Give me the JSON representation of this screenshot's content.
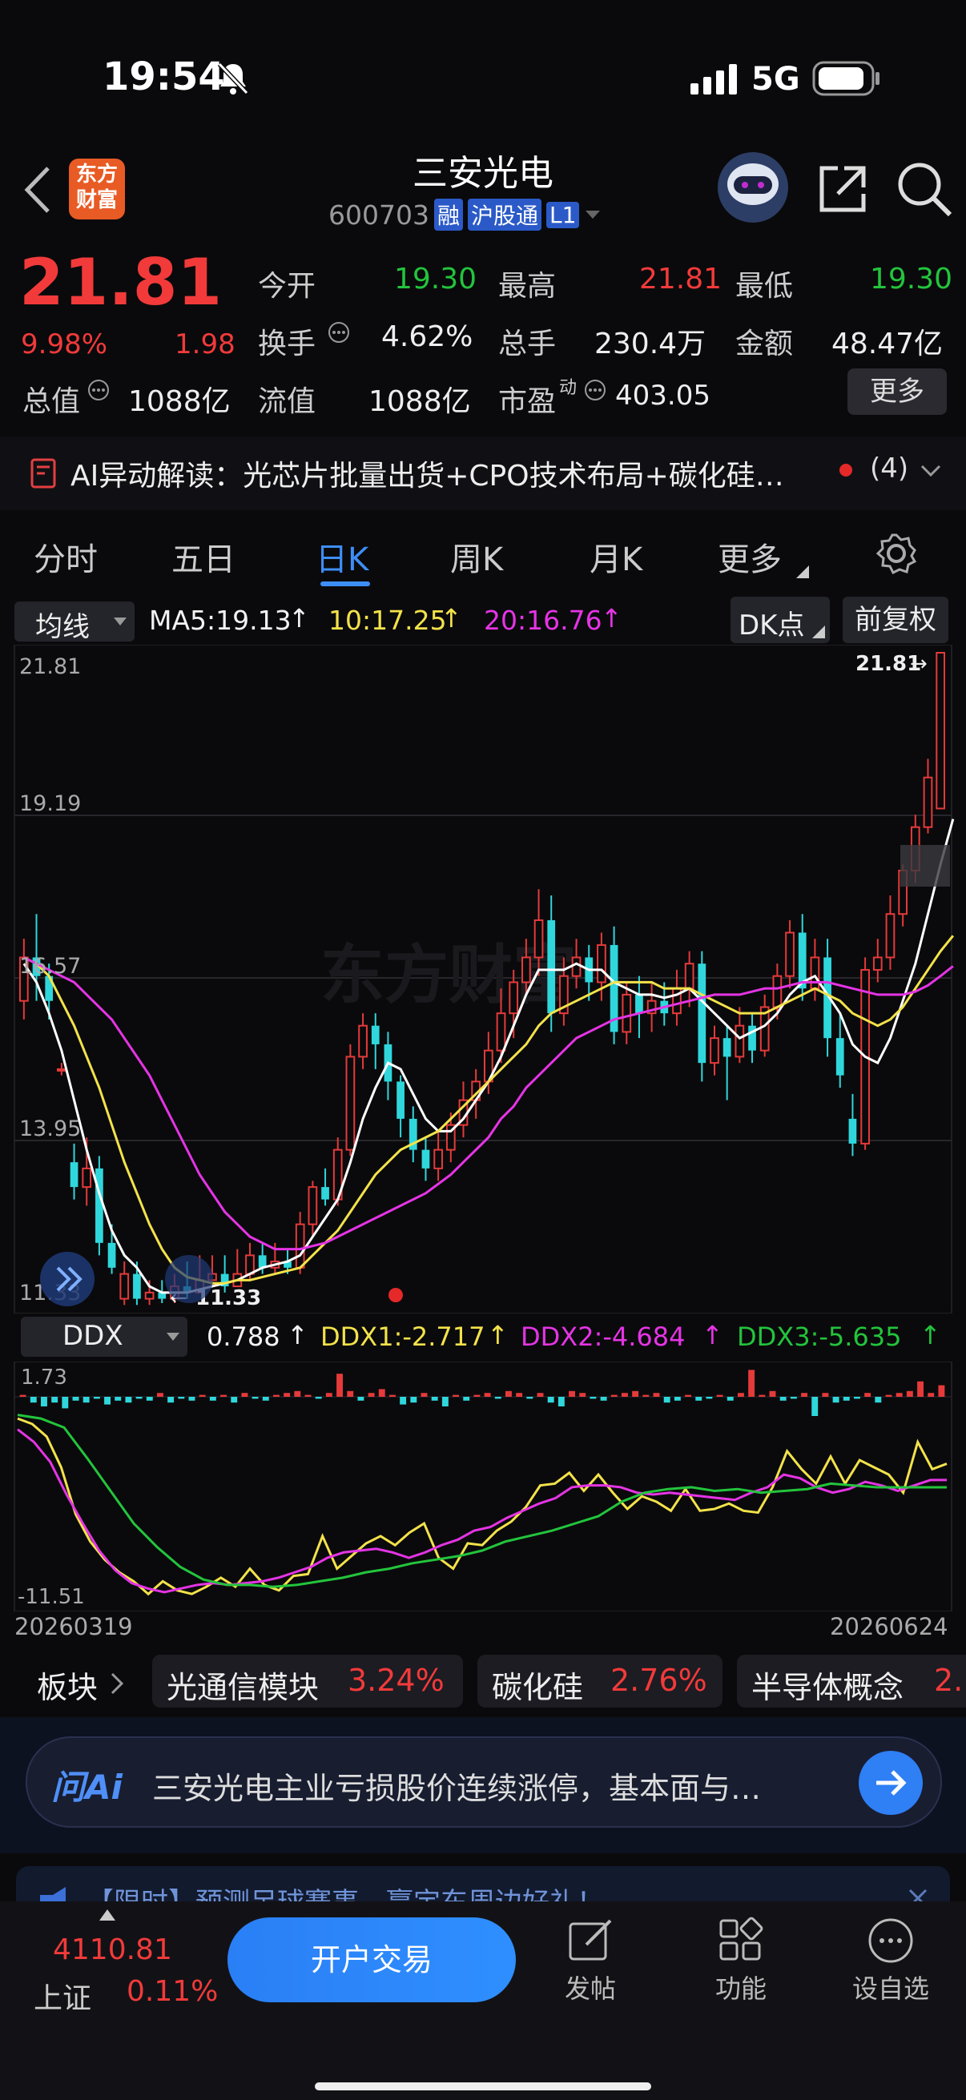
{
  "status_bar": {
    "time": "19:54",
    "network": "5G"
  },
  "header": {
    "back_icon": "chevron-left-icon",
    "logo_text_line1": "东方",
    "logo_text_line2": "财富",
    "title": "三安光电",
    "code": "600703",
    "badges": [
      "融",
      "沪股通",
      "L1"
    ]
  },
  "quote": {
    "price": "21.81",
    "change_pct": "9.98%",
    "change": "1.98",
    "labels": {
      "open": "今开",
      "high": "最高",
      "low": "最低",
      "turnover": "换手",
      "volume": "总手",
      "amount": "金额",
      "mktcap": "总值",
      "float": "流值",
      "pe": "市盈",
      "pe_sup": "动",
      "more": "更多"
    },
    "values": {
      "open": "19.30",
      "high": "21.81",
      "low": "19.30",
      "turnover": "4.62%",
      "volume": "230.4万",
      "amount": "48.47亿",
      "mktcap": "1088亿",
      "float": "1088亿",
      "pe": "403.05"
    }
  },
  "ai_banner": {
    "text": "AI异动解读：光芯片批量出货+CPO技术布局+碳化硅…",
    "count": "(4)"
  },
  "tabs": [
    "分时",
    "五日",
    "日K",
    "周K",
    "月K",
    "更多"
  ],
  "active_tab": "日K",
  "ma_bar": {
    "selector": "均线",
    "ma5": "MA5:19.13",
    "ma10": "10:17.25",
    "ma20": "20:16.76",
    "dk_label": "DK点",
    "restore_label": "前复权"
  },
  "chart_data": {
    "type": "line",
    "title": "",
    "y_ticks": [
      "21.81",
      "19.19",
      "16.57",
      "13.95",
      "11.33"
    ],
    "ylim": [
      11.33,
      21.81
    ],
    "price_high_label": "21.81",
    "price_low_label": "11.33",
    "x_start": "20260319",
    "x_end": "20260624",
    "watermark": "东方财富",
    "candles": [
      {
        "o": 16.2,
        "c": 16.9,
        "h": 17.2,
        "l": 15.9
      },
      {
        "o": 16.9,
        "c": 16.6,
        "h": 17.6,
        "l": 16.2
      },
      {
        "o": 16.6,
        "c": 16.2,
        "h": 16.8,
        "l": 15.9
      },
      {
        "o": 15.1,
        "c": 15.1,
        "h": 15.2,
        "l": 15.0
      },
      {
        "o": 13.6,
        "c": 13.2,
        "h": 13.9,
        "l": 13.0
      },
      {
        "o": 13.2,
        "c": 13.5,
        "h": 14.0,
        "l": 12.9
      },
      {
        "o": 13.5,
        "c": 12.3,
        "h": 13.7,
        "l": 12.1
      },
      {
        "o": 12.3,
        "c": 11.9,
        "h": 12.6,
        "l": 11.8
      },
      {
        "o": 11.4,
        "c": 11.8,
        "h": 12.0,
        "l": 11.3
      },
      {
        "o": 11.8,
        "c": 11.4,
        "h": 12.0,
        "l": 11.3
      },
      {
        "o": 11.4,
        "c": 11.5,
        "h": 11.7,
        "l": 11.3
      },
      {
        "o": 11.5,
        "c": 11.4,
        "h": 11.7,
        "l": 11.33
      },
      {
        "o": 11.4,
        "c": 11.6,
        "h": 11.8,
        "l": 11.33
      },
      {
        "o": 11.6,
        "c": 11.5,
        "h": 12.0,
        "l": 11.4
      },
      {
        "o": 11.5,
        "c": 11.7,
        "h": 12.1,
        "l": 11.5
      },
      {
        "o": 11.7,
        "c": 11.8,
        "h": 12.1,
        "l": 11.6
      },
      {
        "o": 11.8,
        "c": 11.6,
        "h": 12.1,
        "l": 11.5
      },
      {
        "o": 11.6,
        "c": 11.8,
        "h": 12.2,
        "l": 11.6
      },
      {
        "o": 11.8,
        "c": 12.1,
        "h": 12.3,
        "l": 11.7
      },
      {
        "o": 12.1,
        "c": 11.9,
        "h": 12.3,
        "l": 11.8
      },
      {
        "o": 11.9,
        "c": 12.0,
        "h": 12.3,
        "l": 11.8
      },
      {
        "o": 12.0,
        "c": 11.9,
        "h": 12.2,
        "l": 11.8
      },
      {
        "o": 11.9,
        "c": 12.6,
        "h": 12.8,
        "l": 11.8
      },
      {
        "o": 12.6,
        "c": 13.2,
        "h": 13.3,
        "l": 12.4
      },
      {
        "o": 13.2,
        "c": 13.0,
        "h": 13.5,
        "l": 12.9
      },
      {
        "o": 13.0,
        "c": 13.8,
        "h": 14.0,
        "l": 12.9
      },
      {
        "o": 13.8,
        "c": 15.3,
        "h": 15.5,
        "l": 13.7
      },
      {
        "o": 15.3,
        "c": 15.8,
        "h": 16.0,
        "l": 15.1
      },
      {
        "o": 15.8,
        "c": 15.5,
        "h": 16.0,
        "l": 15.1
      },
      {
        "o": 15.5,
        "c": 14.9,
        "h": 15.7,
        "l": 14.6
      },
      {
        "o": 14.9,
        "c": 14.3,
        "h": 15.0,
        "l": 14.0
      },
      {
        "o": 14.3,
        "c": 13.8,
        "h": 14.5,
        "l": 13.6
      },
      {
        "o": 13.8,
        "c": 13.5,
        "h": 14.0,
        "l": 13.3
      },
      {
        "o": 13.5,
        "c": 13.8,
        "h": 14.1,
        "l": 13.3
      },
      {
        "o": 13.8,
        "c": 14.2,
        "h": 14.4,
        "l": 13.6
      },
      {
        "o": 14.2,
        "c": 14.6,
        "h": 14.9,
        "l": 14.0
      },
      {
        "o": 14.6,
        "c": 14.9,
        "h": 15.1,
        "l": 14.3
      },
      {
        "o": 14.9,
        "c": 15.4,
        "h": 15.7,
        "l": 14.7
      },
      {
        "o": 15.4,
        "c": 16.0,
        "h": 16.4,
        "l": 15.2
      },
      {
        "o": 16.0,
        "c": 16.5,
        "h": 16.7,
        "l": 15.6
      },
      {
        "o": 16.5,
        "c": 16.9,
        "h": 17.2,
        "l": 16.3
      },
      {
        "o": 16.9,
        "c": 17.5,
        "h": 18.0,
        "l": 16.6
      },
      {
        "o": 17.5,
        "c": 16.0,
        "h": 17.9,
        "l": 15.7
      },
      {
        "o": 16.0,
        "c": 16.6,
        "h": 16.9,
        "l": 15.8
      },
      {
        "o": 16.6,
        "c": 16.9,
        "h": 17.2,
        "l": 16.4
      },
      {
        "o": 16.9,
        "c": 16.5,
        "h": 17.1,
        "l": 16.2
      },
      {
        "o": 16.5,
        "c": 17.1,
        "h": 17.3,
        "l": 16.2
      },
      {
        "o": 17.1,
        "c": 15.7,
        "h": 17.4,
        "l": 15.5
      },
      {
        "o": 15.7,
        "c": 16.3,
        "h": 16.5,
        "l": 15.5
      },
      {
        "o": 16.3,
        "c": 16.0,
        "h": 16.6,
        "l": 15.6
      },
      {
        "o": 16.0,
        "c": 16.2,
        "h": 16.5,
        "l": 15.7
      },
      {
        "o": 16.2,
        "c": 16.0,
        "h": 16.5,
        "l": 15.8
      },
      {
        "o": 16.0,
        "c": 16.4,
        "h": 16.7,
        "l": 15.8
      },
      {
        "o": 16.4,
        "c": 16.8,
        "h": 17.0,
        "l": 16.1
      },
      {
        "o": 16.8,
        "c": 15.2,
        "h": 17.0,
        "l": 14.9
      },
      {
        "o": 15.2,
        "c": 15.6,
        "h": 15.8,
        "l": 15.0
      },
      {
        "o": 15.6,
        "c": 15.3,
        "h": 15.8,
        "l": 14.6
      },
      {
        "o": 15.3,
        "c": 15.8,
        "h": 16.1,
        "l": 15.2
      },
      {
        "o": 15.8,
        "c": 15.4,
        "h": 16.0,
        "l": 15.2
      },
      {
        "o": 15.4,
        "c": 16.1,
        "h": 16.3,
        "l": 15.3
      },
      {
        "o": 16.1,
        "c": 16.6,
        "h": 16.8,
        "l": 15.9
      },
      {
        "o": 16.6,
        "c": 17.3,
        "h": 17.5,
        "l": 16.4
      },
      {
        "o": 17.3,
        "c": 16.4,
        "h": 17.6,
        "l": 16.2
      },
      {
        "o": 16.4,
        "c": 16.9,
        "h": 17.2,
        "l": 16.2
      },
      {
        "o": 16.9,
        "c": 15.6,
        "h": 17.2,
        "l": 15.3
      },
      {
        "o": 15.6,
        "c": 15.0,
        "h": 16.0,
        "l": 14.8
      },
      {
        "o": 14.3,
        "c": 13.9,
        "h": 14.7,
        "l": 13.7
      },
      {
        "o": 13.9,
        "c": 16.7,
        "h": 16.9,
        "l": 13.8
      },
      {
        "o": 16.7,
        "c": 16.9,
        "h": 17.2,
        "l": 16.5
      },
      {
        "o": 16.9,
        "c": 17.6,
        "h": 17.9,
        "l": 16.7
      },
      {
        "o": 17.6,
        "c": 18.3,
        "h": 18.4,
        "l": 17.4
      },
      {
        "o": 18.3,
        "c": 19.0,
        "h": 19.2,
        "l": 18.1
      },
      {
        "o": 19.0,
        "c": 19.8,
        "h": 20.1,
        "l": 18.9
      },
      {
        "o": 19.3,
        "c": 21.81,
        "h": 21.81,
        "l": 19.3
      }
    ],
    "series": [
      {
        "name": "MA5",
        "color": "#ffffff",
        "values": [
          16.8,
          16.5,
          16.0,
          15.4,
          14.6,
          13.8,
          13.1,
          12.5,
          12.1,
          11.9,
          11.6,
          11.5,
          11.5,
          11.5,
          11.55,
          11.6,
          11.65,
          11.7,
          11.8,
          11.9,
          11.95,
          12.0,
          12.1,
          12.4,
          12.7,
          13.0,
          13.6,
          14.3,
          14.8,
          15.2,
          15.1,
          14.7,
          14.3,
          14.1,
          14.1,
          14.3,
          14.6,
          14.9,
          15.3,
          15.8,
          16.3,
          16.7,
          16.7,
          16.7,
          16.8,
          16.7,
          16.7,
          16.5,
          16.4,
          16.3,
          16.3,
          16.25,
          16.3,
          16.4,
          16.2,
          16.0,
          15.8,
          15.6,
          15.7,
          15.8,
          16.0,
          16.3,
          16.5,
          16.6,
          16.3,
          16.0,
          15.5,
          15.3,
          15.2,
          15.6,
          16.2,
          16.8,
          17.6,
          18.4,
          19.13
        ]
      },
      {
        "name": "",
        "color": "#f3e24a",
        "values": [
          16.9,
          16.8,
          16.6,
          16.2,
          15.8,
          15.3,
          14.8,
          14.2,
          13.6,
          13.1,
          12.6,
          12.2,
          11.9,
          11.75,
          11.7,
          11.65,
          11.65,
          11.7,
          11.7,
          11.75,
          11.8,
          11.85,
          11.9,
          12.1,
          12.3,
          12.5,
          12.8,
          13.1,
          13.4,
          13.6,
          13.8,
          13.9,
          14.0,
          14.1,
          14.3,
          14.5,
          14.7,
          14.9,
          15.1,
          15.3,
          15.5,
          15.8,
          16.0,
          16.1,
          16.2,
          16.3,
          16.4,
          16.5,
          16.5,
          16.5,
          16.5,
          16.4,
          16.4,
          16.4,
          16.3,
          16.2,
          16.1,
          16.0,
          16.0,
          16.0,
          16.1,
          16.2,
          16.3,
          16.4,
          16.3,
          16.2,
          16.0,
          15.9,
          15.8,
          15.9,
          16.1,
          16.4,
          16.7,
          17.0,
          17.25
        ]
      },
      {
        "name": "",
        "color": "#e534e5",
        "values": [
          16.9,
          16.8,
          16.7,
          16.6,
          16.5,
          16.3,
          16.1,
          15.9,
          15.6,
          15.3,
          15.0,
          14.6,
          14.2,
          13.8,
          13.4,
          13.1,
          12.8,
          12.6,
          12.4,
          12.3,
          12.2,
          12.2,
          12.2,
          12.25,
          12.3,
          12.4,
          12.5,
          12.6,
          12.7,
          12.8,
          12.9,
          13.0,
          13.1,
          13.25,
          13.4,
          13.6,
          13.8,
          14.0,
          14.3,
          14.5,
          14.8,
          15.0,
          15.2,
          15.4,
          15.6,
          15.7,
          15.8,
          15.9,
          15.95,
          16.0,
          16.05,
          16.1,
          16.15,
          16.2,
          16.25,
          16.3,
          16.3,
          16.3,
          16.35,
          16.4,
          16.4,
          16.45,
          16.5,
          16.5,
          16.5,
          16.45,
          16.4,
          16.35,
          16.3,
          16.3,
          16.3,
          16.35,
          16.45,
          16.6,
          16.76
        ]
      }
    ]
  },
  "ddx": {
    "selector": "DDX",
    "value": "0.788",
    "ddx1": "DDX1:-2.717",
    "ddx2": "DDX2:-4.684",
    "ddx3": "DDX3:-5.635",
    "y_top": "1.73",
    "y_bottom": "-11.51",
    "bars": [
      0.1,
      -0.3,
      -0.5,
      -0.3,
      -0.6,
      -0.2,
      -0.3,
      -0.1,
      -0.4,
      -0.2,
      -0.3,
      -0.1,
      -0.2,
      0.2,
      -0.3,
      -0.1,
      -0.2,
      0.1,
      -0.2,
      0.1,
      -0.3,
      0.2,
      -0.1,
      -0.2,
      0.1,
      0.2,
      0.3,
      0.1,
      -0.1,
      0.2,
      1.2,
      0.3,
      -0.2,
      0.2,
      0.4,
      0.1,
      -0.4,
      -0.3,
      0.2,
      -0.2,
      -0.5,
      0.1,
      -0.2,
      0.1,
      0.2,
      -0.1,
      0.3,
      0.2,
      -0.1,
      0.2,
      -0.3,
      -0.5,
      0.3,
      0.2,
      -0.1,
      -0.2,
      0.1,
      0.2,
      0.3,
      0.1,
      0.2,
      -0.3,
      -0.2,
      0.1,
      -0.2,
      -0.1,
      0.1,
      -0.2,
      0.2,
      1.4,
      0.1,
      0.3,
      -0.2,
      -0.1,
      0.2,
      -1.0,
      0.2,
      -0.3,
      -0.2,
      -0.1,
      0.2,
      -0.3,
      0.1,
      0.2,
      0.3,
      0.8,
      0.2,
      0.6
    ],
    "lines": [
      {
        "name": "DDX1",
        "color": "#f3e24a",
        "values": [
          -1.2,
          -1.5,
          -2.2,
          -3.9,
          -6.5,
          -8.0,
          -9.0,
          -9.7,
          -10.2,
          -10.9,
          -10.2,
          -10.7,
          -10.9,
          -10.5,
          -10.0,
          -10.5,
          -9.5,
          -10.4,
          -10.7,
          -9.9,
          -9.8,
          -7.7,
          -9.5,
          -8.8,
          -8.1,
          -7.7,
          -8.2,
          -7.5,
          -7.0,
          -8.9,
          -9.5,
          -8.1,
          -8.2,
          -7.4,
          -6.9,
          -6.1,
          -4.9,
          -4.8,
          -4.2,
          -5.2,
          -4.3,
          -5.3,
          -6.2,
          -5.5,
          -5.8,
          -6.3,
          -5.1,
          -6.3,
          -6.2,
          -5.9,
          -6.3,
          -6.4,
          -5.0,
          -3.0,
          -4.0,
          -4.8,
          -3.3,
          -4.8,
          -3.5,
          -3.9,
          -4.3,
          -5.3,
          -2.5,
          -4.0,
          -3.7
        ]
      },
      {
        "name": "DDX2",
        "color": "#e534e5",
        "values": [
          -1.8,
          -2.5,
          -3.6,
          -5.4,
          -7.0,
          -8.5,
          -9.6,
          -10.3,
          -10.6,
          -10.8,
          -10.6,
          -10.4,
          -10.3,
          -10.4,
          -10.3,
          -10.2,
          -10.0,
          -9.7,
          -9.4,
          -8.9,
          -8.6,
          -8.5,
          -8.4,
          -8.6,
          -8.9,
          -8.6,
          -8.2,
          -7.9,
          -7.4,
          -7.2,
          -6.7,
          -6.3,
          -5.9,
          -5.6,
          -5.0,
          -4.9,
          -4.9,
          -5.0,
          -5.3,
          -5.4,
          -5.3,
          -5.4,
          -5.5,
          -5.6,
          -5.7,
          -5.3,
          -5.0,
          -4.3,
          -4.5,
          -5.0,
          -5.3,
          -5.1,
          -4.7,
          -4.9,
          -5.2,
          -4.9,
          -4.6,
          -4.6
        ]
      },
      {
        "name": "DDX3",
        "color": "#23c43c",
        "values": [
          -1.0,
          -1.2,
          -1.7,
          -3.4,
          -5.2,
          -7.0,
          -8.3,
          -9.4,
          -10.1,
          -10.4,
          -10.4,
          -10.5,
          -10.4,
          -10.2,
          -10.0,
          -9.7,
          -9.5,
          -9.2,
          -9.0,
          -8.8,
          -8.5,
          -8.0,
          -7.7,
          -7.4,
          -7.0,
          -6.6,
          -5.8,
          -5.3,
          -5.1,
          -5.0,
          -5.2,
          -5.1,
          -5.3,
          -5.2,
          -5.1,
          -4.8,
          -4.9,
          -5.0,
          -5.0,
          -5.0,
          -5.0
        ]
      }
    ],
    "x_start": "20260319",
    "x_end": "20260624"
  },
  "sectors": {
    "label": "板块",
    "items": [
      {
        "name": "光通信模块",
        "pct": "3.24%"
      },
      {
        "name": "碳化硅",
        "pct": "2.76%"
      },
      {
        "name": "半导体概念",
        "pct": "2."
      }
    ]
  },
  "ask_ai": {
    "label": "问Ai",
    "text": "三安光电主业亏损股价连续涨停，基本面与…"
  },
  "notice": {
    "text": "【限时】预测足球赛事，赢定东周边好礼！"
  },
  "bottom_bar": {
    "index_value": "4110.81",
    "index_name": "上证",
    "index_pct": "0.11%",
    "trade_button": "开户交易",
    "post": "发帖",
    "func": "功能",
    "watch": "设自选"
  }
}
